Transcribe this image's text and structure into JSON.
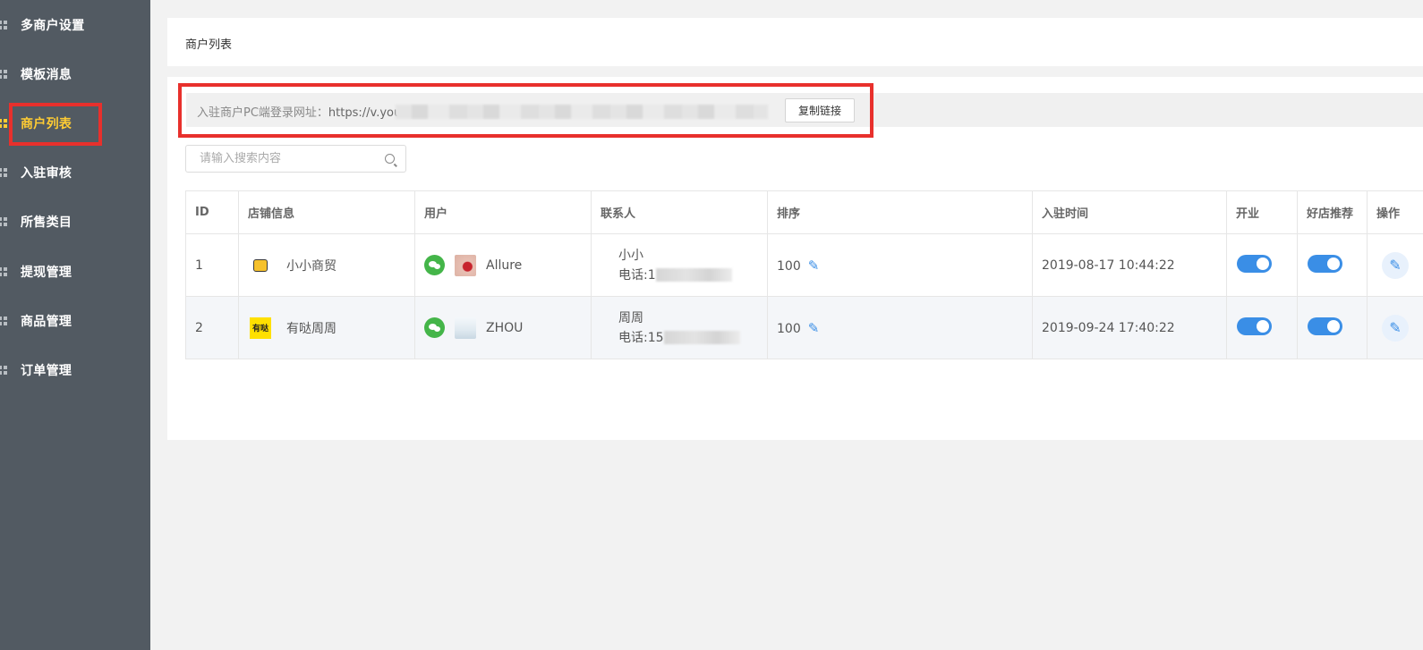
{
  "sidebar": {
    "items": [
      {
        "label": "多商户设置"
      },
      {
        "label": "模板消息"
      },
      {
        "label": "商户列表",
        "active": true
      },
      {
        "label": "入驻审核"
      },
      {
        "label": "所售类目"
      },
      {
        "label": "提现管理"
      },
      {
        "label": "商品管理"
      },
      {
        "label": "订单管理"
      }
    ]
  },
  "header": {
    "title": "商户列表"
  },
  "url_bar": {
    "label": "入驻商户PC端登录网址：",
    "url": "https://v.youd",
    "copy_button": "复制链接"
  },
  "search": {
    "placeholder": "请输入搜索内容"
  },
  "table": {
    "headers": [
      "ID",
      "店铺信息",
      "用户",
      "联系人",
      "排序",
      "入驻时间",
      "开业",
      "好店推荐",
      "操作"
    ],
    "rows": [
      {
        "id": "1",
        "shop": "小小商贸",
        "shop_logo_text": "",
        "user": "Allure",
        "contact_name": "小小",
        "phone_prefix": "电话:1",
        "sort": "100",
        "time": "2019-08-17 10:44:22",
        "open": true,
        "recommend": true
      },
      {
        "id": "2",
        "shop": "有哒周周",
        "shop_logo_text": "有哒",
        "user": "ZHOU",
        "contact_name": "周周",
        "phone_prefix": "电话:15",
        "sort": "100",
        "time": "2019-09-24 17:40:22",
        "open": true,
        "recommend": true
      }
    ]
  },
  "colors": {
    "sidebar_bg": "#525a62",
    "active": "#ffcc33",
    "highlight": "#e8302c",
    "primary": "#3a8ee6",
    "wechat": "#44b549"
  },
  "icons": {
    "menu": "grid-icon",
    "search": "search-icon",
    "edit": "pencil-icon",
    "wechat": "wechat-icon"
  }
}
